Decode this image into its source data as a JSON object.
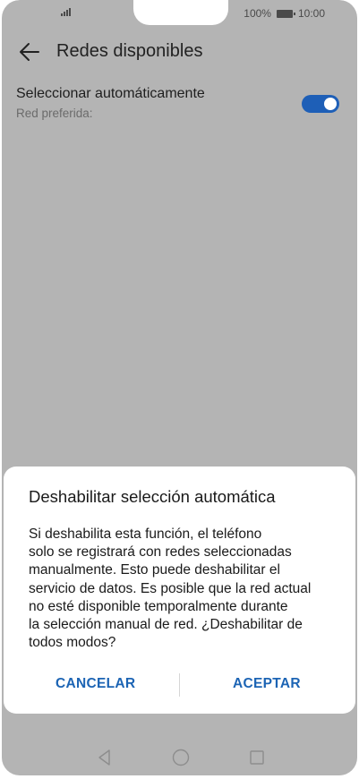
{
  "status_bar": {
    "battery_percent": "100%",
    "time": "10:00"
  },
  "app_bar": {
    "title": "Redes disponibles",
    "back_icon": "arrow-left-icon"
  },
  "setting": {
    "title": "Seleccionar automáticamente",
    "subtitle": "Red preferida:",
    "toggle_on": true
  },
  "dialog": {
    "title": "Deshabilitar selección automática",
    "body_lines": [
      "Si deshabilita esta función, el teléfono",
      "solo se registrará con redes seleccionadas",
      "manualmente. Esto puede deshabilitar el",
      "servicio de datos. Es posible que la red actual",
      "no esté disponible temporalmente durante",
      "la selección manual de red. ¿Deshabilitar de",
      "todos modos?"
    ],
    "cancel_label": "CANCELAR",
    "accept_label": "ACEPTAR"
  },
  "nav_bar": {
    "icons": [
      "nav-back-icon",
      "nav-home-icon",
      "nav-recent-icon"
    ]
  },
  "colors": {
    "accent": "#1c64b4",
    "toggle": "#1e5fb7",
    "scrim_background": "#b4b4b4"
  }
}
